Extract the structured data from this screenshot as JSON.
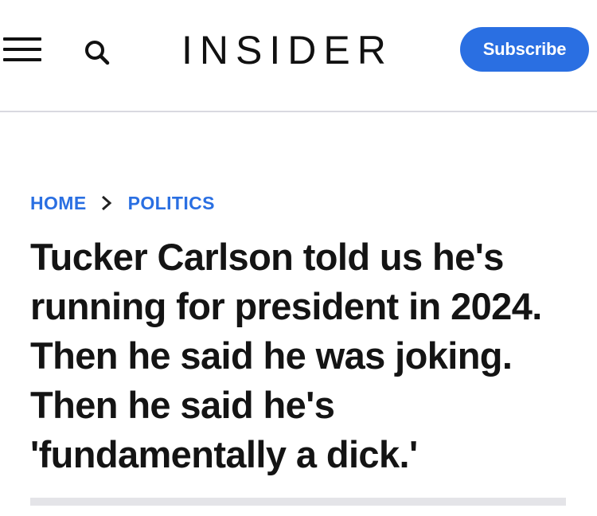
{
  "header": {
    "menu_icon": "hamburger-menu-icon",
    "search_icon": "search-icon",
    "logo_text": "INSIDER",
    "subscribe_label": "Subscribe"
  },
  "breadcrumb": {
    "items": [
      "HOME",
      "POLITICS"
    ],
    "separator_icon": "chevron-right-icon"
  },
  "article": {
    "headline": "Tucker Carlson told us he's running for president in 2024. Then he said he was joking. Then he said he's 'fundamentally a dick.'"
  },
  "colors": {
    "accent": "#2a6fe2",
    "text": "#141414",
    "divider": "#e4e4e8"
  }
}
